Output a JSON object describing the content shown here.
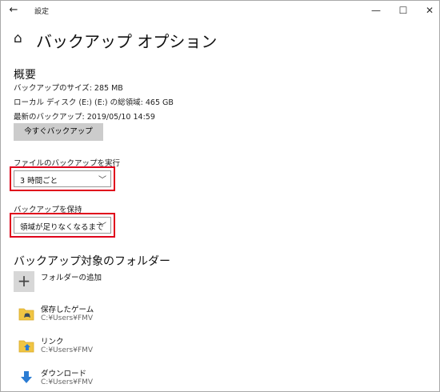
{
  "titlebar": {
    "back_glyph": "←",
    "title": "設定",
    "minimize_glyph": "—",
    "maximize_glyph": "☐",
    "close_glyph": "✕"
  },
  "header": {
    "home_glyph": "⌂",
    "title": "バックアップ オプション"
  },
  "overview": {
    "heading": "概要",
    "size_line": "バックアップのサイズ: 285 MB",
    "disk_line": "ローカル ディスク (E:) (E:) の総領域: 465 GB",
    "latest_line": "最新のバックアップ: 2019/05/10 14:59",
    "backup_now_label": "今すぐバックアップ"
  },
  "frequency": {
    "label": "ファイルのバックアップを実行",
    "value": "3 時間ごと",
    "chevron": "﹀"
  },
  "retention": {
    "label": "バックアップを保持",
    "value": "領域が足りなくなるまで",
    "chevron": "﹀"
  },
  "folders": {
    "heading": "バックアップ対象のフォルダー",
    "add_glyph": "+",
    "add_label": "フォルダーの追加",
    "items": [
      {
        "name": "保存したゲーム",
        "path": "C:¥Users¥FMV",
        "icon": "saved-games-folder-icon"
      },
      {
        "name": "リンク",
        "path": "C:¥Users¥FMV",
        "icon": "links-folder-icon"
      },
      {
        "name": "ダウンロード",
        "path": "C:¥Users¥FMV",
        "icon": "download-arrow-icon"
      }
    ]
  },
  "colors": {
    "highlight_border": "#e0001b",
    "button_gray": "#cccccc",
    "folder_yellow": "#f0c543",
    "download_blue": "#2b7cd3"
  }
}
